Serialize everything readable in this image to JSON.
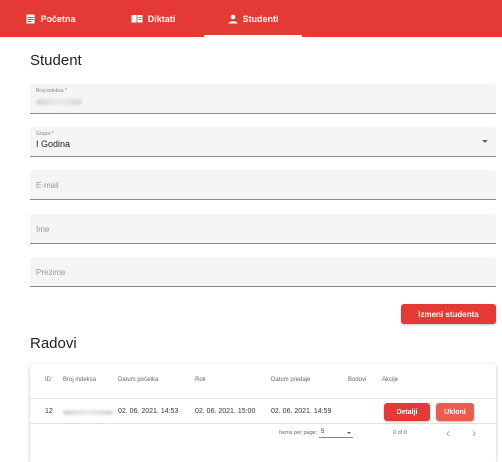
{
  "nav": {
    "tabs": [
      {
        "label": "Početna",
        "icon": "document-icon"
      },
      {
        "label": "Diktati",
        "icon": "book-icon"
      },
      {
        "label": "Studenti",
        "icon": "person-icon"
      }
    ],
    "active": "Studenti"
  },
  "student": {
    "title": "Student",
    "broj_indeksa": {
      "label": "Broj indeksa *"
    },
    "grupa": {
      "label": "Grupa *",
      "value": "I Godina"
    },
    "email": {
      "placeholder": "E-mail"
    },
    "ime": {
      "placeholder": "Ime"
    },
    "prezime": {
      "placeholder": "Prezime"
    },
    "submit_label": "Izmeni studenta"
  },
  "radovi": {
    "title": "Radovi",
    "columns": [
      "ID",
      "Broj indeksa",
      "Datum početka",
      "Rok",
      "Datum predaje",
      "Bodovi",
      "Akcije"
    ],
    "rows": [
      {
        "id": "12",
        "datum_pocetka": "02. 06. 2021. 14:53",
        "rok": "02. 06. 2021. 15:00",
        "datum_predaje": "02. 06. 2021. 14:59",
        "bodovi": "",
        "detalji_label": "Detalji",
        "ukloni_label": "Ukloni"
      }
    ],
    "paginator": {
      "items_per_page_label": "Items per page:",
      "page_size": "5",
      "range_label": "0 of 0",
      "prev": "‹",
      "next": "›"
    }
  },
  "colors": {
    "primary": "#e53935",
    "secondary_button": "#ef5a4f"
  }
}
